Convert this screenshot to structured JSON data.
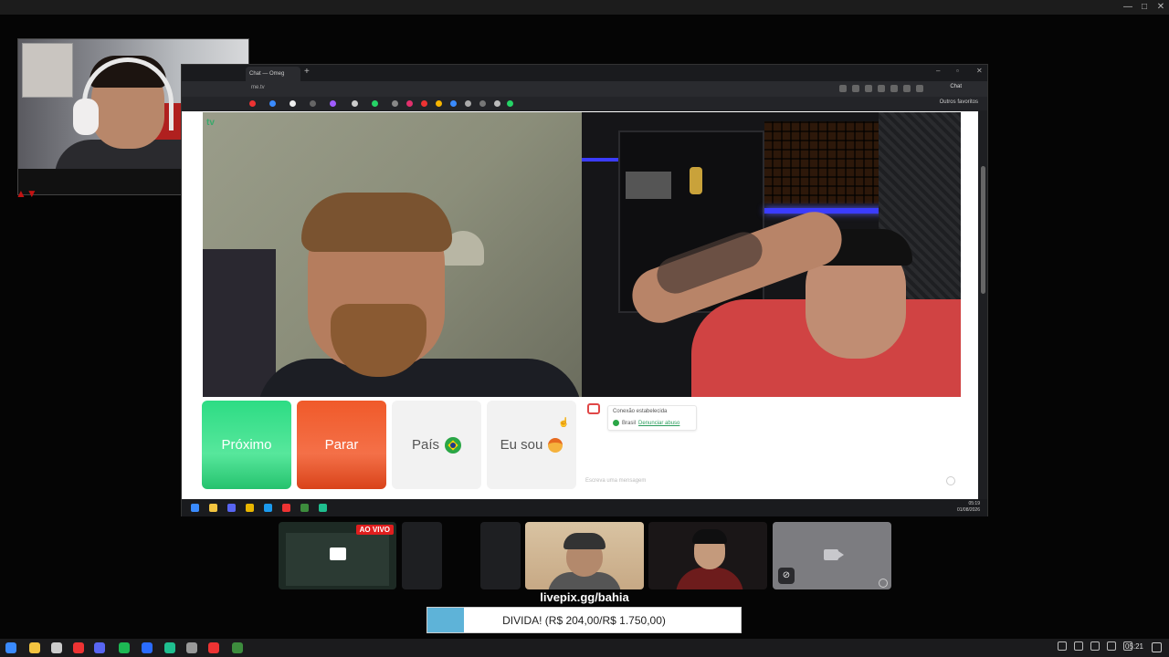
{
  "outer_window": {
    "minimize_glyph": "—",
    "maximize_glyph": "□",
    "close_glyph": "✕"
  },
  "browser": {
    "tab_title": "Chat — Omeg",
    "new_tab_glyph": "+",
    "url": "me.tv",
    "chat_button": "Chat",
    "bookmarks_folder": "Outros favoritos",
    "win_min": "–",
    "win_max": "▫",
    "win_close": "✕"
  },
  "site": {
    "logo": "tv",
    "buttons": {
      "next": "Próximo",
      "stop": "Parar",
      "country": "País",
      "i_am": "Eu sou"
    },
    "chat": {
      "status": "Conexão estabelecida",
      "country": "Brasil",
      "report_link": "Denunciar abuso",
      "input_placeholder": "Escreva uma mensagem"
    }
  },
  "inner_taskbar": {
    "time": "05:19",
    "date": "01/08/2026"
  },
  "participants": {
    "live_badge": "AO VIVO"
  },
  "donation": {
    "link": "livepix.gg/bahia",
    "goal_text": "DIVIDA! (R$ 204,00/R$ 1.750,00)",
    "progress_fraction": 0.117
  },
  "taskbar": {
    "clock": "05:21"
  },
  "colors": {
    "next_button": "#2ddc84",
    "stop_button": "#f05a2a",
    "live_badge": "#e01e1e",
    "goal_fill": "#5eb3d8"
  }
}
